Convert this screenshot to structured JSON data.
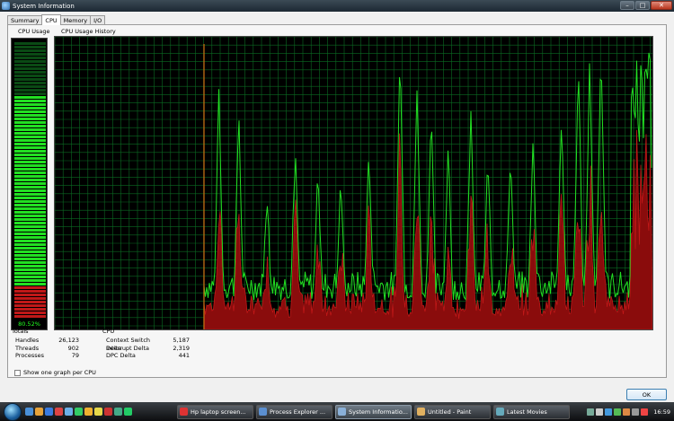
{
  "window": {
    "title": "System Information"
  },
  "tabs": [
    {
      "label": "Summary",
      "active": false
    },
    {
      "label": "CPU",
      "active": true
    },
    {
      "label": "Memory",
      "active": false
    },
    {
      "label": "I/O",
      "active": false
    }
  ],
  "cpu_usage": {
    "label": "CPU Usage",
    "percent_text": "80.52%",
    "level": 0.8052
  },
  "history": {
    "label": "CPU Usage History"
  },
  "totals": {
    "heading": "Totals",
    "rows": [
      {
        "label": "Handles",
        "value": "26,123"
      },
      {
        "label": "Threads",
        "value": "902"
      },
      {
        "label": "Processes",
        "value": "79"
      }
    ]
  },
  "cpu_stats": {
    "heading": "CPU",
    "rows": [
      {
        "label": "Context Switch Delta",
        "value": "5,187"
      },
      {
        "label": "Interrupt Delta",
        "value": "2,319"
      },
      {
        "label": "DPC Delta",
        "value": "441"
      }
    ]
  },
  "checkbox": {
    "label": "Show one graph per CPU",
    "checked": false
  },
  "ok_button": {
    "label": "OK"
  },
  "colors": {
    "graph_green": "#22e022",
    "graph_red": "#c01818",
    "grid": "#0b6a22"
  },
  "taskbar": {
    "buttons": [
      {
        "label": "Hp laptop screen...",
        "active": false
      },
      {
        "label": "Process Explorer ...",
        "active": false
      },
      {
        "label": "System Informatio...",
        "active": true
      },
      {
        "label": "Untitled - Paint",
        "active": false
      },
      {
        "label": "Latest Movies",
        "active": false
      }
    ],
    "clock": "16:59"
  }
}
